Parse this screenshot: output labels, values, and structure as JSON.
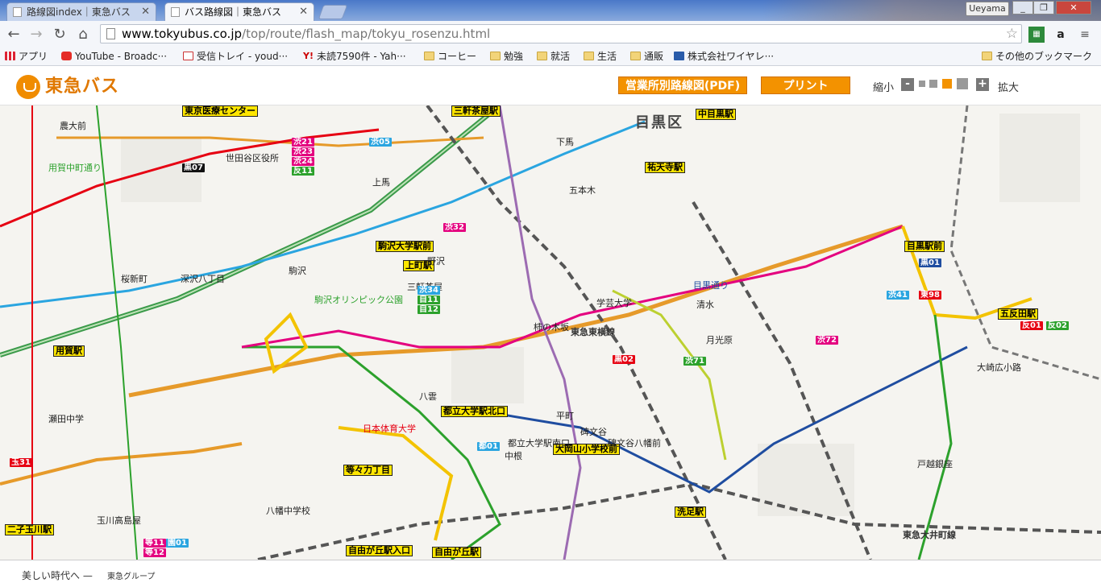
{
  "browser": {
    "tabs": [
      {
        "title": "路線図index｜東急バス",
        "active": false
      },
      {
        "title": "バス路線図｜東急バス",
        "active": true
      }
    ],
    "user_name": "Ueyama",
    "url_host": "www.tokyubus.co.jp",
    "url_path": "/top/route/flash_map/tokyu_rosenzu.html",
    "bookmarks": [
      {
        "label": "アプリ",
        "icon": "apps-grid-icon"
      },
      {
        "label": "YouTube - Broadc···",
        "icon": "youtube-icon"
      },
      {
        "label": "受信トレイ - youd···",
        "icon": "gmail-icon"
      },
      {
        "label": "未読7590件 - Yah···",
        "icon": "yahoo-icon"
      },
      {
        "label": "コーヒー",
        "icon": "folder-icon"
      },
      {
        "label": "勉強",
        "icon": "folder-icon"
      },
      {
        "label": "就活",
        "icon": "folder-icon"
      },
      {
        "label": "生活",
        "icon": "folder-icon"
      },
      {
        "label": "通販",
        "icon": "folder-icon"
      },
      {
        "label": "株式会社ワイヤレ···",
        "icon": "site-icon"
      }
    ],
    "other_bookmarks": "その他のブックマーク"
  },
  "header": {
    "logo_text": "東急バス",
    "pdf_button": "営業所別路線図(PDF)",
    "print_button": "プリント",
    "zoom_out_label": "縮小",
    "zoom_in_label": "拡大",
    "zoom_minus": "-",
    "zoom_plus": "+",
    "zoom_level": 4,
    "zoom_steps": 5
  },
  "map": {
    "areas": [
      "目黒区"
    ],
    "stations": [
      "駒沢大学駅前",
      "中目黒駅",
      "目黒駅前",
      "五反田駅",
      "祐天寺駅",
      "大岡山小学校前",
      "洗足駅",
      "都立大学駅北口",
      "等々力丁目",
      "自由が丘駅入口",
      "用賀駅",
      "二子玉川駅",
      "上町駅",
      "東京医療センター",
      "三軒茶屋駅",
      "自由が丘駅"
    ],
    "stops": [
      "世田谷区役所",
      "農大前",
      "三軒茶屋",
      "深沢八丁目",
      "学芸大学",
      "碑文谷",
      "清水",
      "八雲",
      "柿の木坂",
      "月光原",
      "大崎広小路",
      "戸越銀座",
      "駒沢",
      "野沢",
      "下馬",
      "上馬",
      "八幡中学校",
      "五本木",
      "中根",
      "碑文谷八幡前",
      "都立大学駅南口",
      "平町",
      "桜新町",
      "瀬田中学",
      "玉川高島屋"
    ],
    "routes": [
      {
        "code": "渋05",
        "color": "#2aa5e0"
      },
      {
        "code": "黒07",
        "color": "#111111"
      },
      {
        "code": "渋21",
        "color": "#e4007f"
      },
      {
        "code": "渋23",
        "color": "#e4007f"
      },
      {
        "code": "渋24",
        "color": "#e4007f"
      },
      {
        "code": "反11",
        "color": "#2ca12c"
      },
      {
        "code": "渋32",
        "color": "#e4007f"
      },
      {
        "code": "渋34",
        "color": "#2aa5e0"
      },
      {
        "code": "自11",
        "color": "#2ca12c"
      },
      {
        "code": "自12",
        "color": "#2ca12c"
      },
      {
        "code": "渋41",
        "color": "#2aa5e0"
      },
      {
        "code": "黒01",
        "color": "#1f4da0"
      },
      {
        "code": "黒02",
        "color": "#e60012"
      },
      {
        "code": "東98",
        "color": "#e60012"
      },
      {
        "code": "渋71",
        "color": "#2ca12c"
      },
      {
        "code": "渋72",
        "color": "#e4007f"
      },
      {
        "code": "反01",
        "color": "#e60012"
      },
      {
        "code": "反02",
        "color": "#2ca12c"
      },
      {
        "code": "玉31",
        "color": "#e60012"
      },
      {
        "code": "等11",
        "color": "#e4007f"
      },
      {
        "code": "等12",
        "color": "#e4007f"
      },
      {
        "code": "園01",
        "color": "#2aa5e0"
      },
      {
        "code": "都01",
        "color": "#2aa5e0"
      }
    ],
    "landmarks": [
      "駒沢オリンピック公園",
      "日本体育大学",
      "東急東横線",
      "東急大井町線",
      "目黒通り",
      "用賀中町通り"
    ]
  },
  "footer": {
    "slogan": "美しい時代へ —",
    "group": "東急グループ"
  },
  "colors": {
    "brand_orange": "#f39200",
    "route_red": "#e60012",
    "route_blue": "#2aa5e0",
    "route_green": "#2ca12c"
  }
}
